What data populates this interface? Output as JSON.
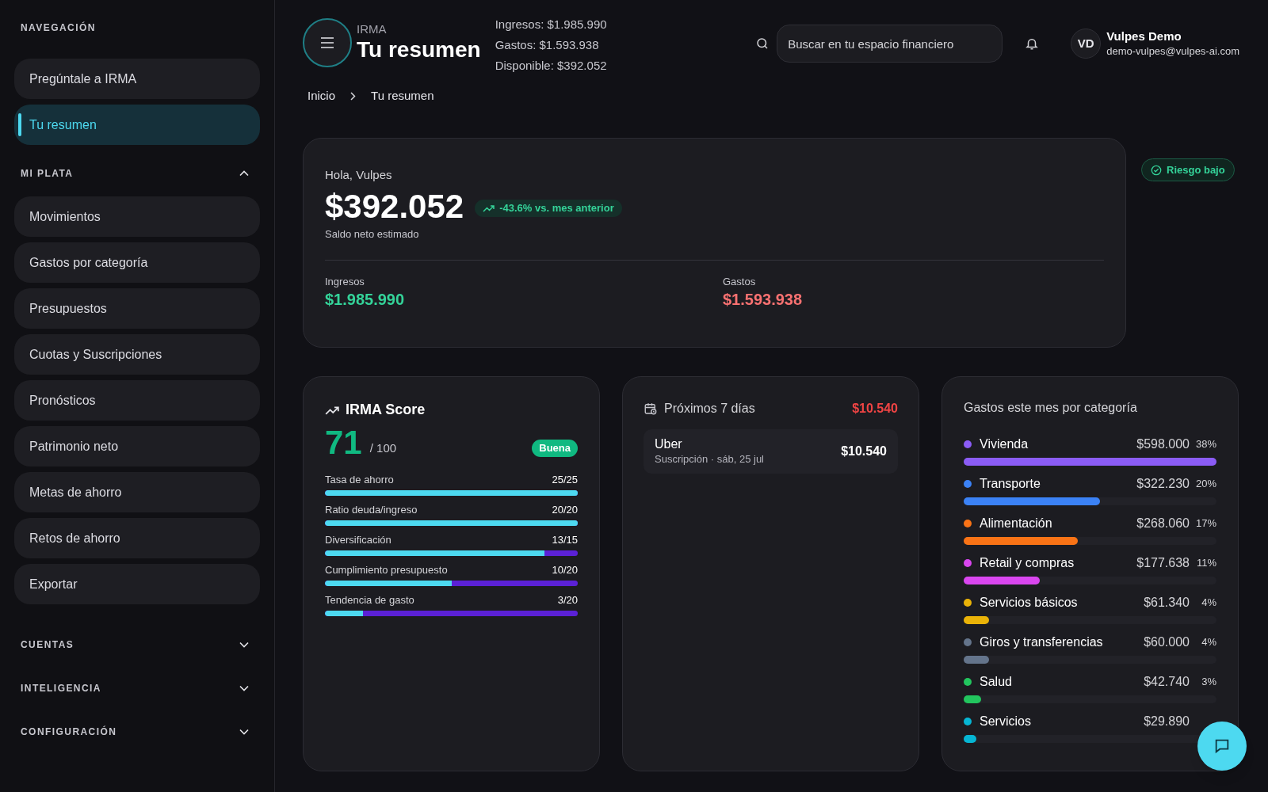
{
  "sidebar": {
    "sections": [
      {
        "title": "NAVEGACIÓN",
        "kind": "plain",
        "items": [
          {
            "label": "Pregúntale a IRMA",
            "selected": false
          },
          {
            "label": "Tu resumen",
            "selected": true
          }
        ]
      },
      {
        "title": "MI PLATA",
        "kind": "collapsible",
        "expanded": true,
        "items": [
          {
            "label": "Movimientos",
            "selected": false
          },
          {
            "label": "Gastos por categoría",
            "selected": false
          },
          {
            "label": "Presupuestos",
            "selected": false
          },
          {
            "label": "Cuotas y Suscripciones",
            "selected": false
          },
          {
            "label": "Pronósticos",
            "selected": false
          },
          {
            "label": "Patrimonio neto",
            "selected": false
          },
          {
            "label": "Metas de ahorro",
            "selected": false
          },
          {
            "label": "Retos de ahorro",
            "selected": false
          },
          {
            "label": "Exportar",
            "selected": false
          }
        ]
      },
      {
        "title": "CUENTAS",
        "kind": "collapsible",
        "expanded": false
      },
      {
        "title": "INTELIGENCIA",
        "kind": "collapsible",
        "expanded": false
      },
      {
        "title": "CONFIGURACIÓN",
        "kind": "collapsible",
        "expanded": false
      }
    ]
  },
  "header": {
    "app_name": "IRMA",
    "page_title": "Tu resumen",
    "summary": [
      "Ingresos: $1.985.990",
      "Gastos: $1.593.938",
      "Disponible: $392.052"
    ],
    "search": {
      "placeholder": "Buscar en tu espacio financiero"
    },
    "user": {
      "initials": "VD",
      "name": "Vulpes Demo",
      "email": "demo-vulpes@vulpes-ai.com"
    }
  },
  "breadcrumb": [
    "Inicio",
    "Tu resumen"
  ],
  "overview": {
    "greeting": "Hola, Vulpes",
    "balance": "$392.052",
    "change": "-43.6% vs. mes anterior",
    "balance_label": "Saldo neto estimado",
    "income": {
      "label": "Ingresos",
      "value": "$1.985.990"
    },
    "expenses": {
      "label": "Gastos",
      "value": "$1.593.938"
    }
  },
  "risk_badge": "Riesgo bajo",
  "score": {
    "title": "IRMA Score",
    "value": "71",
    "max": "/ 100",
    "rating": "Buena",
    "factors": [
      {
        "label": "Tasa de ahorro",
        "reading": "25/25",
        "level": 1
      },
      {
        "label": "Ratio deuda/ingreso",
        "reading": "20/20",
        "level": 1
      },
      {
        "label": "Diversificación",
        "reading": "13/15",
        "level": 0.867
      },
      {
        "label": "Cumplimiento presupuesto",
        "reading": "10/20",
        "level": 0.5
      },
      {
        "label": "Tendencia de gasto",
        "reading": "3/20",
        "level": 0.15
      }
    ]
  },
  "upcoming": {
    "title": "Próximos 7 días",
    "total": "$10.540",
    "items": [
      {
        "name": "Uber",
        "detail": "Suscripción · sáb, 25 jul",
        "amount": "$10.540"
      }
    ]
  },
  "categories": {
    "title": "Gastos este mes por categoría",
    "items": [
      {
        "name": "Vivienda",
        "amount": "$598.000",
        "share": "38%",
        "level": 1,
        "color": "#8b5cf6"
      },
      {
        "name": "Transporte",
        "amount": "$322.230",
        "share": "20%",
        "level": 0.54,
        "color": "#3b82f6"
      },
      {
        "name": "Alimentación",
        "amount": "$268.060",
        "share": "17%",
        "level": 0.45,
        "color": "#f97316"
      },
      {
        "name": "Retail y compras",
        "amount": "$177.638",
        "share": "11%",
        "level": 0.3,
        "color": "#d946ef"
      },
      {
        "name": "Servicios básicos",
        "amount": "$61.340",
        "share": "4%",
        "level": 0.1,
        "color": "#eab308"
      },
      {
        "name": "Giros y transferencias",
        "amount": "$60.000",
        "share": "4%",
        "level": 0.1,
        "color": "#64748b"
      },
      {
        "name": "Salud",
        "amount": "$42.740",
        "share": "3%",
        "level": 0.07,
        "color": "#22c55e"
      },
      {
        "name": "Servicios",
        "amount": "$29.890",
        "level": 0.05,
        "color": "#06b6d4"
      }
    ]
  }
}
